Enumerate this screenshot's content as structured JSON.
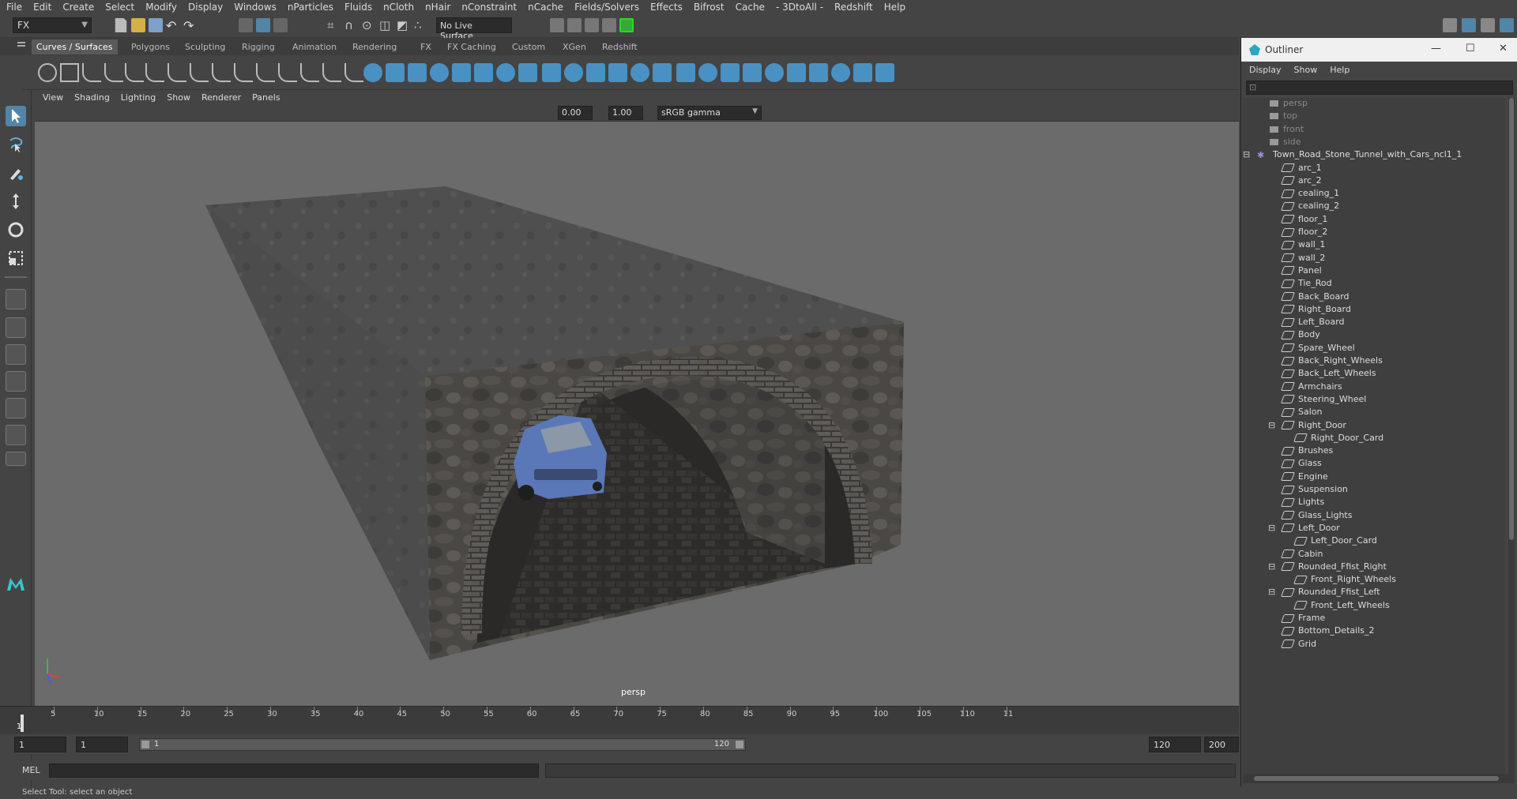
{
  "menu": [
    "File",
    "Edit",
    "Create",
    "Select",
    "Modify",
    "Display",
    "Windows",
    "nParticles",
    "Fluids",
    "nCloth",
    "nHair",
    "nConstraint",
    "nCache",
    "Fields/Solvers",
    "Effects",
    "Bifrost",
    "Cache",
    "- 3DtoAll -",
    "Redshift",
    "Help"
  ],
  "toolbar": {
    "mode": "FX",
    "live_surface": "No Live Surface"
  },
  "shelf_tabs": [
    "Curves / Surfaces",
    "Polygons",
    "Sculpting",
    "Rigging",
    "Animation",
    "Rendering",
    "FX",
    "FX Caching",
    "Custom",
    "XGen",
    "Redshift"
  ],
  "shelf_active": "Curves / Surfaces",
  "viewport": {
    "menu": [
      "View",
      "Shading",
      "Lighting",
      "Show",
      "Renderer",
      "Panels"
    ],
    "near_value": "0.00",
    "far_value": "1.00",
    "color_space": "sRGB gamma",
    "camera_label": "persp"
  },
  "timeline": {
    "ticks": [
      "5",
      "10",
      "15",
      "20",
      "25",
      "30",
      "35",
      "40",
      "45",
      "50",
      "55",
      "60",
      "65",
      "70",
      "75",
      "80",
      "85",
      "90",
      "95",
      "100",
      "105",
      "110",
      "11"
    ],
    "current_frame": "1"
  },
  "range": {
    "start": "1",
    "playback_start": "1",
    "slider_start": "1",
    "slider_end": "120",
    "playback_end": "120",
    "end": "200"
  },
  "mel": {
    "label": "MEL"
  },
  "status": "Select Tool: select an object",
  "outliner": {
    "title": "Outliner",
    "menu": [
      "Display",
      "Show",
      "Help"
    ],
    "items": [
      {
        "label": "persp",
        "depth": 0,
        "kind": "camera"
      },
      {
        "label": "top",
        "depth": 0,
        "kind": "camera"
      },
      {
        "label": "front",
        "depth": 0,
        "kind": "camera"
      },
      {
        "label": "side",
        "depth": 0,
        "kind": "camera"
      },
      {
        "label": "Town_Road_Stone_Tunnel_with_Cars_ncl1_1",
        "depth": 0,
        "kind": "group",
        "expanded": true
      },
      {
        "label": "arc_1",
        "depth": 1,
        "kind": "mesh"
      },
      {
        "label": "arc_2",
        "depth": 1,
        "kind": "mesh"
      },
      {
        "label": "cealing_1",
        "depth": 1,
        "kind": "mesh"
      },
      {
        "label": "cealing_2",
        "depth": 1,
        "kind": "mesh"
      },
      {
        "label": "floor_1",
        "depth": 1,
        "kind": "mesh"
      },
      {
        "label": "floor_2",
        "depth": 1,
        "kind": "mesh"
      },
      {
        "label": "wall_1",
        "depth": 1,
        "kind": "mesh"
      },
      {
        "label": "wall_2",
        "depth": 1,
        "kind": "mesh"
      },
      {
        "label": "Panel",
        "depth": 1,
        "kind": "mesh"
      },
      {
        "label": "Tie_Rod",
        "depth": 1,
        "kind": "mesh"
      },
      {
        "label": "Back_Board",
        "depth": 1,
        "kind": "mesh"
      },
      {
        "label": "Right_Board",
        "depth": 1,
        "kind": "mesh"
      },
      {
        "label": "Left_Board",
        "depth": 1,
        "kind": "mesh"
      },
      {
        "label": "Body",
        "depth": 1,
        "kind": "mesh"
      },
      {
        "label": "Spare_Wheel",
        "depth": 1,
        "kind": "mesh"
      },
      {
        "label": "Back_Right_Wheels",
        "depth": 1,
        "kind": "mesh"
      },
      {
        "label": "Back_Left_Wheels",
        "depth": 1,
        "kind": "mesh"
      },
      {
        "label": "Armchairs",
        "depth": 1,
        "kind": "mesh"
      },
      {
        "label": "Steering_Wheel",
        "depth": 1,
        "kind": "mesh"
      },
      {
        "label": "Salon",
        "depth": 1,
        "kind": "mesh"
      },
      {
        "label": "Right_Door",
        "depth": 1,
        "kind": "mesh",
        "expanded": true
      },
      {
        "label": "Right_Door_Card",
        "depth": 2,
        "kind": "mesh"
      },
      {
        "label": "Brushes",
        "depth": 1,
        "kind": "mesh"
      },
      {
        "label": "Glass",
        "depth": 1,
        "kind": "mesh"
      },
      {
        "label": "Engine",
        "depth": 1,
        "kind": "mesh"
      },
      {
        "label": "Suspension",
        "depth": 1,
        "kind": "mesh"
      },
      {
        "label": "Lights",
        "depth": 1,
        "kind": "mesh"
      },
      {
        "label": "Glass_Lights",
        "depth": 1,
        "kind": "mesh"
      },
      {
        "label": "Left_Door",
        "depth": 1,
        "kind": "mesh",
        "expanded": true
      },
      {
        "label": "Left_Door_Card",
        "depth": 2,
        "kind": "mesh"
      },
      {
        "label": "Cabin",
        "depth": 1,
        "kind": "mesh"
      },
      {
        "label": "Rounded_Ffist_Right",
        "depth": 1,
        "kind": "mesh",
        "expanded": true
      },
      {
        "label": "Front_Right_Wheels",
        "depth": 2,
        "kind": "mesh"
      },
      {
        "label": "Rounded_Ffist_Left",
        "depth": 1,
        "kind": "mesh",
        "expanded": true
      },
      {
        "label": "Front_Left_Wheels",
        "depth": 2,
        "kind": "mesh"
      },
      {
        "label": "Frame",
        "depth": 1,
        "kind": "mesh"
      },
      {
        "label": "Bottom_Details_2",
        "depth": 1,
        "kind": "mesh"
      },
      {
        "label": "Grid",
        "depth": 1,
        "kind": "mesh"
      }
    ]
  },
  "colors": {
    "accent": "#5285a6",
    "shelf_green": "#22c02a",
    "car_blue": "#5a78b8"
  }
}
